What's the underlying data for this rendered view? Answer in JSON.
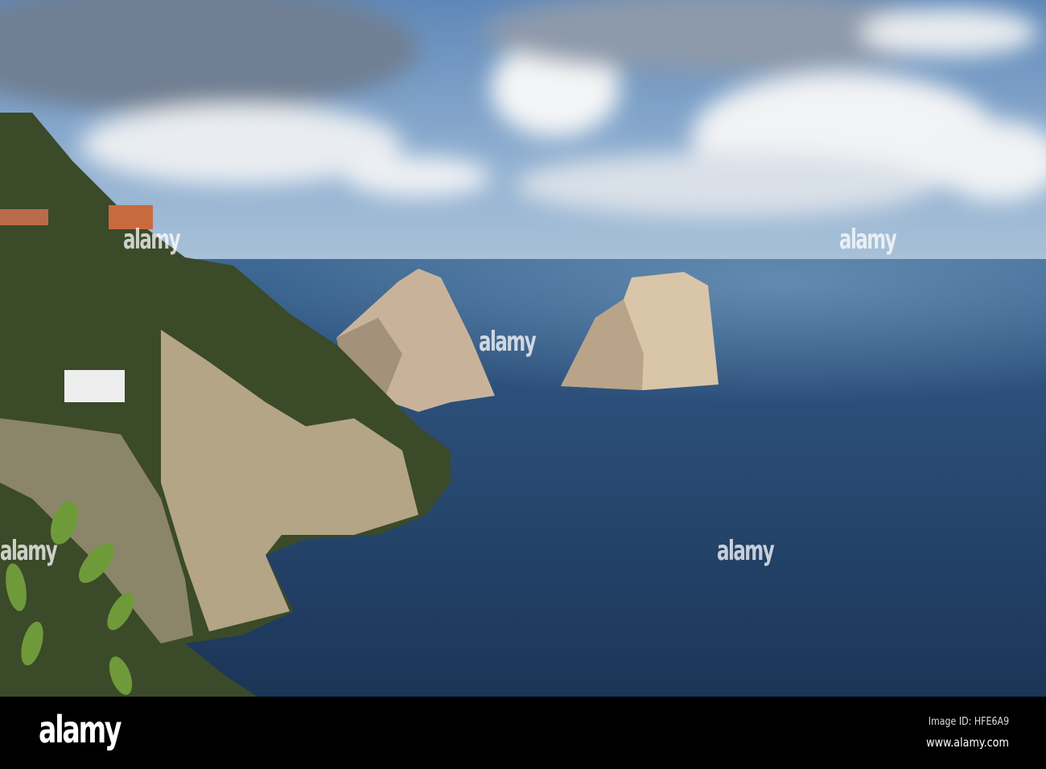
{
  "watermark": {
    "text": "alamy"
  },
  "footer": {
    "logo": "alamy",
    "image_id": "Image ID: HFE6A9",
    "url": "www.alamy.com"
  }
}
